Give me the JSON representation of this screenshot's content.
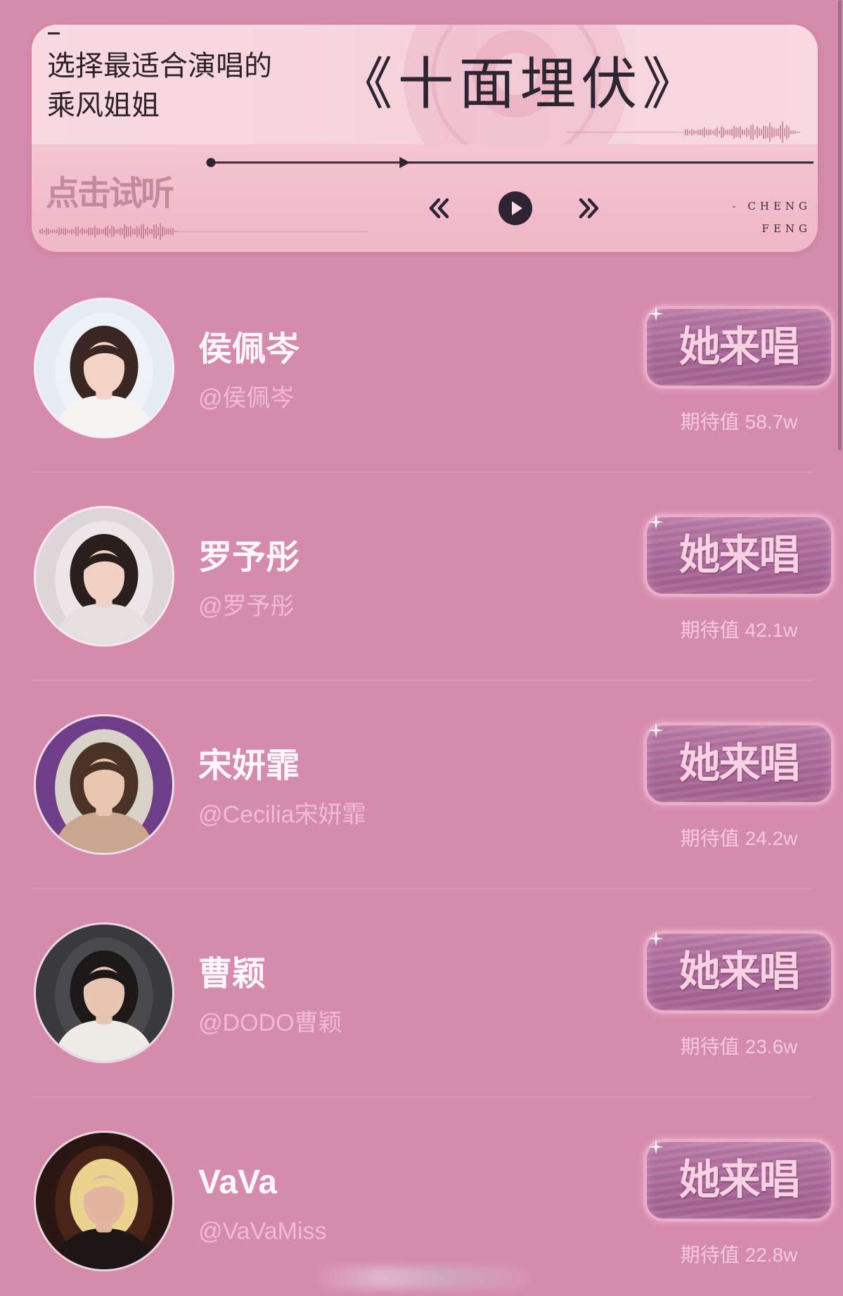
{
  "colors": {
    "page_bg": "#d58bab",
    "card_top": "#f8d9e1",
    "card_bottom": "#f1bccb",
    "ink": "#2e2532",
    "listen": "#c4889f",
    "handle": "#f0bcd1",
    "meta": "#f6cade",
    "button_border": "#eaaecb",
    "button_fill_top": "#b97ba4",
    "button_fill_bottom": "#a2628f",
    "button_text": "#f6d2e3"
  },
  "banner": {
    "subtitle": [
      "选择最适合演唱的",
      "乘风姐姐"
    ],
    "song_title": "《十面埋伏》",
    "listen_label": "点击试听",
    "credit": [
      "- CHENG",
      "FENG"
    ]
  },
  "player": {
    "progress": 0.32,
    "icons": {
      "previous": "double-chevron-left-icon",
      "play": "play-circle-icon",
      "next": "double-chevron-right-icon"
    }
  },
  "singers": [
    {
      "name": "侯佩岑",
      "handle": "@侯佩岑",
      "button_label": "她来唱",
      "expect_label": "期待值",
      "expect_value": "58.7w",
      "avatar": {
        "bg": "#e4ebf3",
        "inner": "#eef2f7",
        "hair": "#3a2622",
        "skin": "#f2d3c6",
        "clothes": "#f6f4f3"
      }
    },
    {
      "name": "罗予彤",
      "handle": "@罗予彤",
      "button_label": "她来唱",
      "expect_label": "期待值",
      "expect_value": "42.1w",
      "avatar": {
        "bg": "#ded5d8",
        "inner": "#ece6e8",
        "hair": "#2b1f1d",
        "skin": "#f1d1c4",
        "clothes": "#e6dfe0"
      }
    },
    {
      "name": "宋妍霏",
      "handle": "@Cecilia宋妍霏",
      "button_label": "她来唱",
      "expect_label": "期待值",
      "expect_value": "24.2w",
      "avatar": {
        "bg": "#6e3f88",
        "inner": "#d9d2c9",
        "hair": "#4a3326",
        "skin": "#eac6ae",
        "clothes": "#c9a58e"
      }
    },
    {
      "name": "曹颖",
      "handle": "@DODO曹颖",
      "button_label": "她来唱",
      "expect_label": "期待值",
      "expect_value": "23.6w",
      "avatar": {
        "bg": "#3a3a3c",
        "inner": "#4a4a4c",
        "hair": "#1c1818",
        "skin": "#e8c5b3",
        "clothes": "#efebe6"
      }
    },
    {
      "name": "VaVa",
      "handle": "@VaVaMiss",
      "button_label": "她来唱",
      "expect_label": "期待值",
      "expect_value": "22.8w",
      "avatar": {
        "bg": "#2a1612",
        "inner": "#4a2418",
        "hair": "#e9d38f",
        "skin": "#e2b69e",
        "clothes": "#1c1616"
      }
    }
  ]
}
